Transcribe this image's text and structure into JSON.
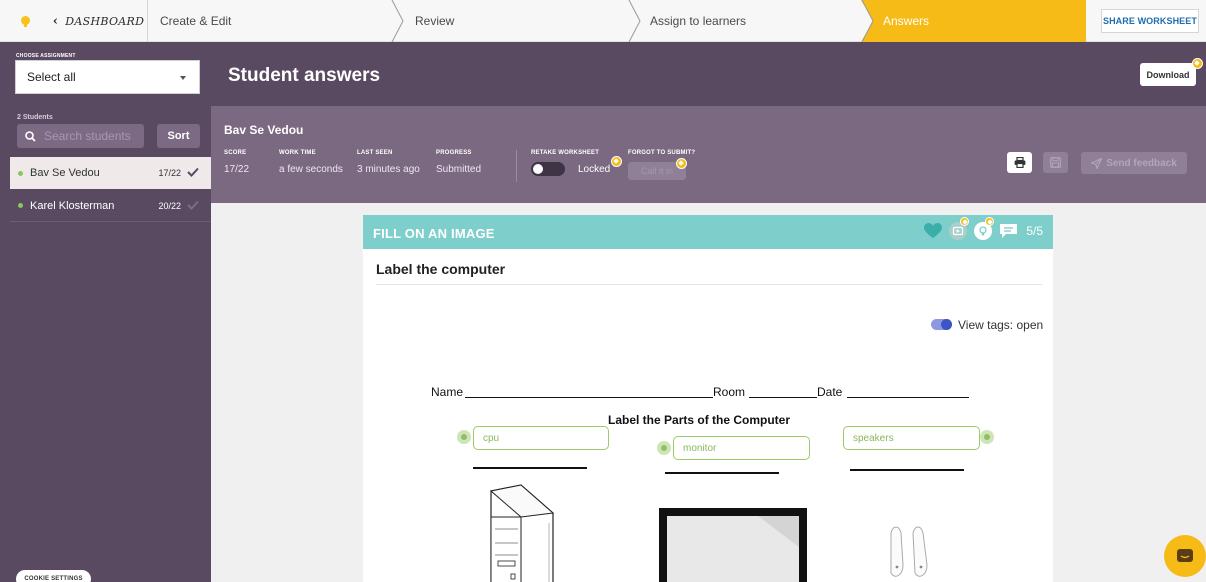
{
  "nav": {
    "dashboard": "DASHBOARD",
    "steps": [
      "Create & Edit",
      "Review",
      "Assign to learners",
      "Answers"
    ],
    "share": "SHARE WORKSHEET"
  },
  "sidebar": {
    "choose_label": "CHOOSE ASSIGNMENT",
    "select_value": "Select all",
    "students_count": "2 Students",
    "search_placeholder": "Search students",
    "sort_label": "Sort",
    "students": [
      {
        "name": "Bav Se Vedou",
        "score": "17/22"
      },
      {
        "name": "Karel Klosterman",
        "score": "20/22"
      }
    ],
    "cookie_label": "COOKIE SETTINGS"
  },
  "header": {
    "title": "Student answers",
    "download_label": "Download"
  },
  "student": {
    "name": "Bav Se Vedou",
    "stats": [
      {
        "label": "SCORE",
        "value": "17/22"
      },
      {
        "label": "WORK TIME",
        "value": "a few seconds"
      },
      {
        "label": "LAST SEEN",
        "value": "3 minutes ago"
      },
      {
        "label": "PROGRESS",
        "value": "Submitted"
      }
    ],
    "retake_label": "RETAKE WORKSHEET",
    "retake_state": "Locked",
    "forgot_label": "FORGOT TO SUBMIT?",
    "call_label": "Call it in",
    "feedback_label": "Send feedback"
  },
  "question": {
    "type": "FILL ON AN IMAGE",
    "count": "5/5",
    "title": "Label the computer",
    "view_tags": "View tags: open",
    "worksheet": {
      "name_label": "Name",
      "room_label": "Room",
      "date_label": "Date",
      "heading": "Label the Parts of the Computer",
      "tags": [
        "cpu",
        "monitor",
        "speakers"
      ]
    }
  },
  "colors": {
    "purple_dark": "#5a4a61",
    "purple_mid": "#7a6981",
    "accent_yellow": "#f6bb17",
    "teal": "#7ecfcb",
    "tag_green": "#9ccb6a"
  }
}
